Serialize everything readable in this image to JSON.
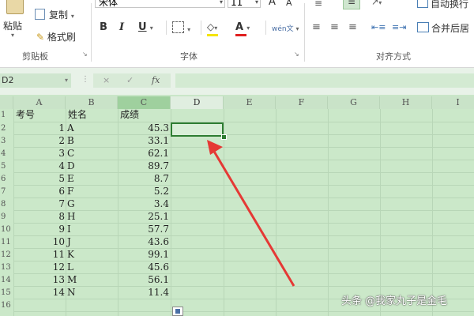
{
  "ribbon": {
    "paste_label": "粘贴",
    "copy_label": "复制",
    "format_painter_label": "格式刷",
    "clipboard_group": "剪贴板",
    "font_name": "宋体",
    "font_size": "11",
    "font_group": "字体",
    "bold": "B",
    "italic": "I",
    "underline": "U",
    "grow_font": "A",
    "shrink_font": "A",
    "font_color": "A",
    "phonetic": "wén文",
    "align_group": "对齐方式",
    "wrap_label": "自动换行",
    "merge_label": "合并后居",
    "dialog_launcher": "↘"
  },
  "formula_bar": {
    "name_box": "D2",
    "fx": "fx",
    "cancel": "×",
    "enter": "✓",
    "value": ""
  },
  "columns": [
    "A",
    "B",
    "C",
    "D",
    "E",
    "F",
    "G",
    "H",
    "I"
  ],
  "rows": [
    "1",
    "2",
    "3",
    "4",
    "5",
    "6",
    "7",
    "8",
    "9",
    "10",
    "11",
    "12",
    "13",
    "14",
    "15",
    "16"
  ],
  "sheet": {
    "headers": [
      "考号",
      "姓名",
      "成绩"
    ],
    "records": [
      {
        "id": "1",
        "name": "A",
        "score": "45.3"
      },
      {
        "id": "2",
        "name": "B",
        "score": "33.1"
      },
      {
        "id": "3",
        "name": "C",
        "score": "62.1"
      },
      {
        "id": "4",
        "name": "D",
        "score": "89.7"
      },
      {
        "id": "5",
        "name": "E",
        "score": "8.7"
      },
      {
        "id": "6",
        "name": "F",
        "score": "5.2"
      },
      {
        "id": "7",
        "name": "G",
        "score": "3.4"
      },
      {
        "id": "8",
        "name": "H",
        "score": "25.1"
      },
      {
        "id": "9",
        "name": "I",
        "score": "57.7"
      },
      {
        "id": "10",
        "name": "J",
        "score": "43.6"
      },
      {
        "id": "11",
        "name": "K",
        "score": "99.1"
      },
      {
        "id": "12",
        "name": "L",
        "score": "45.6"
      },
      {
        "id": "13",
        "name": "M",
        "score": "56.1"
      },
      {
        "id": "14",
        "name": "N",
        "score": "11.4"
      }
    ]
  },
  "watermark": "头条 @我家丸子是金毛",
  "colors": {
    "grid_bg": "#cbe8c9",
    "selection": "#2e7d32",
    "arrow": "#e53935",
    "font_color_underline": "#e02020",
    "highlight_underline": "#f5e400"
  }
}
